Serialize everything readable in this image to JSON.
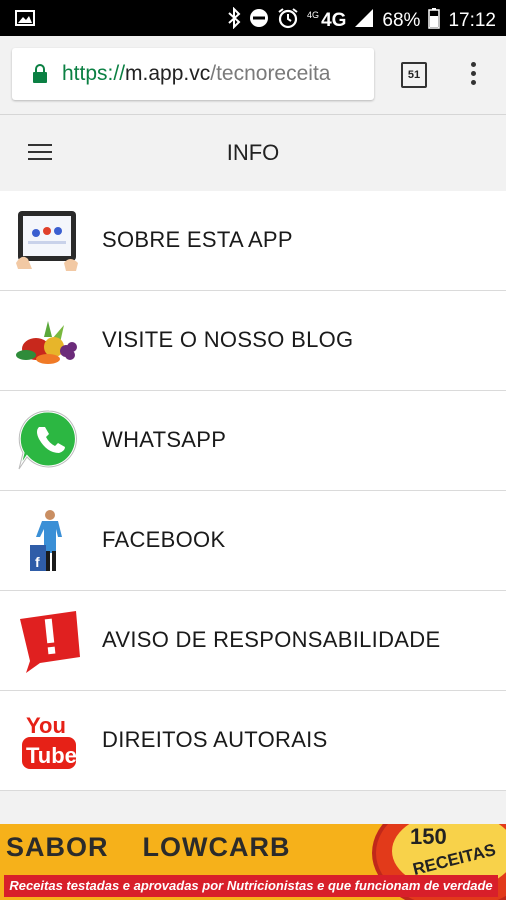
{
  "status_bar": {
    "battery": "68%",
    "time": "17:12",
    "network": "4G",
    "network_small": "4G",
    "icons": [
      "image-icon",
      "bluetooth-icon",
      "do-not-disturb-icon",
      "alarm-icon",
      "signal-icon",
      "battery-icon"
    ]
  },
  "browser": {
    "url_scheme": "https://",
    "url_host": "m.app.vc",
    "url_path": "/tecnoreceita",
    "tab_count": "51"
  },
  "app": {
    "title": "INFO"
  },
  "menu": {
    "items": [
      {
        "label": "SOBRE ESTA APP",
        "icon": "tablet-app-icon"
      },
      {
        "label": "VISITE O NOSSO BLOG",
        "icon": "fruits-icon"
      },
      {
        "label": "WHATSAPP",
        "icon": "whatsapp-icon"
      },
      {
        "label": "FACEBOOK",
        "icon": "facebook-person-icon"
      },
      {
        "label": "AVISO DE RESPONSABILIDADE",
        "icon": "warning-icon"
      },
      {
        "label": "DIREITOS AUTORAIS",
        "icon": "youtube-icon"
      }
    ]
  },
  "ad_banner": {
    "brand_left": "SABOR",
    "brand_right": "LOWCARB",
    "badge_number": "150",
    "badge_text": "RECEITAS",
    "tagline": "Receitas testadas e aprovadas por Nutricionistas e que funcionam de verdade"
  },
  "colors": {
    "secure_green": "#0b8043",
    "whatsapp_green": "#2cb742",
    "youtube_red": "#e62117",
    "warning_red": "#e02020",
    "banner_orange": "#f6b11a"
  }
}
